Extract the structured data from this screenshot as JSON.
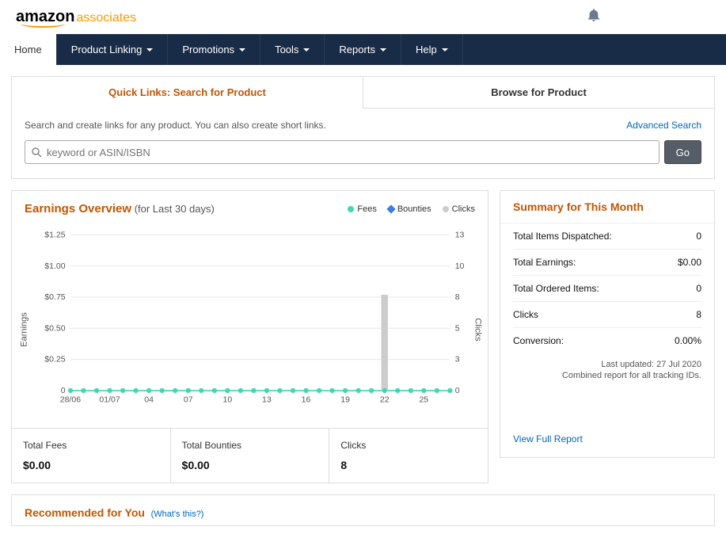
{
  "logo": {
    "brand": "amazon",
    "suffix": "associates"
  },
  "nav": {
    "items": [
      {
        "label": "Home",
        "active": true,
        "dropdown": false
      },
      {
        "label": "Product Linking",
        "active": false,
        "dropdown": true
      },
      {
        "label": "Promotions",
        "active": false,
        "dropdown": true
      },
      {
        "label": "Tools",
        "active": false,
        "dropdown": true
      },
      {
        "label": "Reports",
        "active": false,
        "dropdown": true
      },
      {
        "label": "Help",
        "active": false,
        "dropdown": true
      }
    ]
  },
  "quick_links": {
    "tab_search": "Quick Links: Search for Product",
    "tab_browse": "Browse for Product",
    "description": "Search and create links for any product. You can also create short links.",
    "advanced": "Advanced Search",
    "placeholder": "keyword or ASIN/ISBN",
    "go": "Go"
  },
  "earnings": {
    "title": "Earnings Overview",
    "subtitle": "(for Last 30 days)",
    "legend": {
      "fees": "Fees",
      "bounties": "Bounties",
      "clicks": "Clicks"
    },
    "axis_left": "Earnings",
    "axis_right": "Clicks",
    "totals": [
      {
        "label": "Total Fees",
        "value": "$0.00"
      },
      {
        "label": "Total Bounties",
        "value": "$0.00"
      },
      {
        "label": "Clicks",
        "value": "8"
      }
    ]
  },
  "chart_data": {
    "type": "combo",
    "x_labels": [
      "28/06",
      "01/07",
      "04",
      "07",
      "10",
      "13",
      "16",
      "19",
      "22",
      "25"
    ],
    "y_left_ticks": [
      "0",
      "$0.25",
      "$0.50",
      "$0.75",
      "$1.00",
      "$1.25"
    ],
    "y_right_ticks": [
      "0",
      "3",
      "5",
      "8",
      "10",
      "13"
    ],
    "ylim_left": [
      0,
      1.25
    ],
    "ylim_right": [
      0,
      13
    ],
    "series": [
      {
        "name": "Fees",
        "type": "line",
        "color": "#3dd9b0",
        "x": [
          "28/06",
          "29/06",
          "30/06",
          "01/07",
          "02/07",
          "03/07",
          "04/07",
          "05/07",
          "06/07",
          "07/07",
          "08/07",
          "09/07",
          "10/07",
          "11/07",
          "12/07",
          "13/07",
          "14/07",
          "15/07",
          "16/07",
          "17/07",
          "18/07",
          "19/07",
          "20/07",
          "21/07",
          "22/07",
          "23/07",
          "24/07",
          "25/07",
          "26/07",
          "27/07"
        ],
        "values": [
          0,
          0,
          0,
          0,
          0,
          0,
          0,
          0,
          0,
          0,
          0,
          0,
          0,
          0,
          0,
          0,
          0,
          0,
          0,
          0,
          0,
          0,
          0,
          0,
          0,
          0,
          0,
          0,
          0,
          0
        ]
      },
      {
        "name": "Bounties",
        "type": "line",
        "color": "#3b7dd8",
        "x": [
          "28/06",
          "29/06",
          "30/06",
          "01/07",
          "02/07",
          "03/07",
          "04/07",
          "05/07",
          "06/07",
          "07/07",
          "08/07",
          "09/07",
          "10/07",
          "11/07",
          "12/07",
          "13/07",
          "14/07",
          "15/07",
          "16/07",
          "17/07",
          "18/07",
          "19/07",
          "20/07",
          "21/07",
          "22/07",
          "23/07",
          "24/07",
          "25/07",
          "26/07",
          "27/07"
        ],
        "values": [
          0,
          0,
          0,
          0,
          0,
          0,
          0,
          0,
          0,
          0,
          0,
          0,
          0,
          0,
          0,
          0,
          0,
          0,
          0,
          0,
          0,
          0,
          0,
          0,
          0,
          0,
          0,
          0,
          0,
          0
        ]
      },
      {
        "name": "Clicks",
        "type": "bar",
        "color": "#ccc",
        "x": [
          "28/06",
          "29/06",
          "30/06",
          "01/07",
          "02/07",
          "03/07",
          "04/07",
          "05/07",
          "06/07",
          "07/07",
          "08/07",
          "09/07",
          "10/07",
          "11/07",
          "12/07",
          "13/07",
          "14/07",
          "15/07",
          "16/07",
          "17/07",
          "18/07",
          "19/07",
          "20/07",
          "21/07",
          "22/07",
          "23/07",
          "24/07",
          "25/07",
          "26/07",
          "27/07"
        ],
        "values": [
          0,
          0,
          0,
          0,
          0,
          0,
          0,
          0,
          0,
          0,
          0,
          0,
          0,
          0,
          0,
          0,
          0,
          0,
          0,
          0,
          0,
          0,
          0,
          0,
          8,
          0,
          0,
          0,
          0,
          0
        ]
      }
    ]
  },
  "summary": {
    "title": "Summary for This Month",
    "rows": [
      {
        "label": "Total Items Dispatched:",
        "value": "0"
      },
      {
        "label": "Total Earnings:",
        "value": "$0.00"
      },
      {
        "label": "Total Ordered Items:",
        "value": "0"
      },
      {
        "label": "Clicks",
        "value": "8"
      },
      {
        "label": "Conversion:",
        "value": "0.00%"
      }
    ],
    "updated": "Last updated: 27 Jul 2020",
    "combined": "Combined report for all tracking IDs.",
    "view_report": "View Full Report"
  },
  "recommended": {
    "title": "Recommended for You",
    "whats_this": "(What's this?)"
  }
}
